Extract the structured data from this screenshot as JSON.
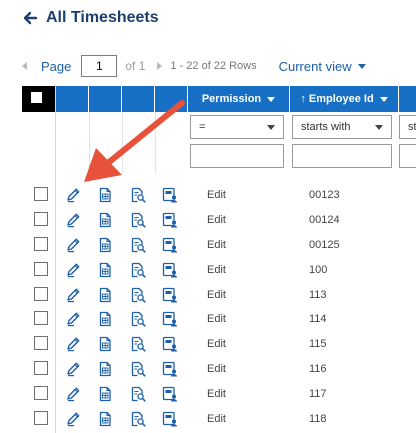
{
  "header": {
    "title": "All Timesheets"
  },
  "pager": {
    "page_label": "Page",
    "page_value": "1",
    "of_label": "of 1",
    "rows_label": "1 - 22 of 22 Rows",
    "view_label": "Current view"
  },
  "columns": {
    "permission": "Permission",
    "employee_id": "↑ Employee Id"
  },
  "filters": {
    "permission_op": "=",
    "employee_op": "starts with",
    "next_op": "st"
  },
  "rows": [
    {
      "permission": "Edit",
      "employee_id": "00123"
    },
    {
      "permission": "Edit",
      "employee_id": "00124"
    },
    {
      "permission": "Edit",
      "employee_id": "00125"
    },
    {
      "permission": "Edit",
      "employee_id": "100"
    },
    {
      "permission": "Edit",
      "employee_id": "113"
    },
    {
      "permission": "Edit",
      "employee_id": "114"
    },
    {
      "permission": "Edit",
      "employee_id": "115"
    },
    {
      "permission": "Edit",
      "employee_id": "116"
    },
    {
      "permission": "Edit",
      "employee_id": "117"
    },
    {
      "permission": "Edit",
      "employee_id": "118"
    }
  ],
  "colors": {
    "accent": "#1d5fa8",
    "header_bg": "#1770c5",
    "arrow": "#e8513a"
  }
}
